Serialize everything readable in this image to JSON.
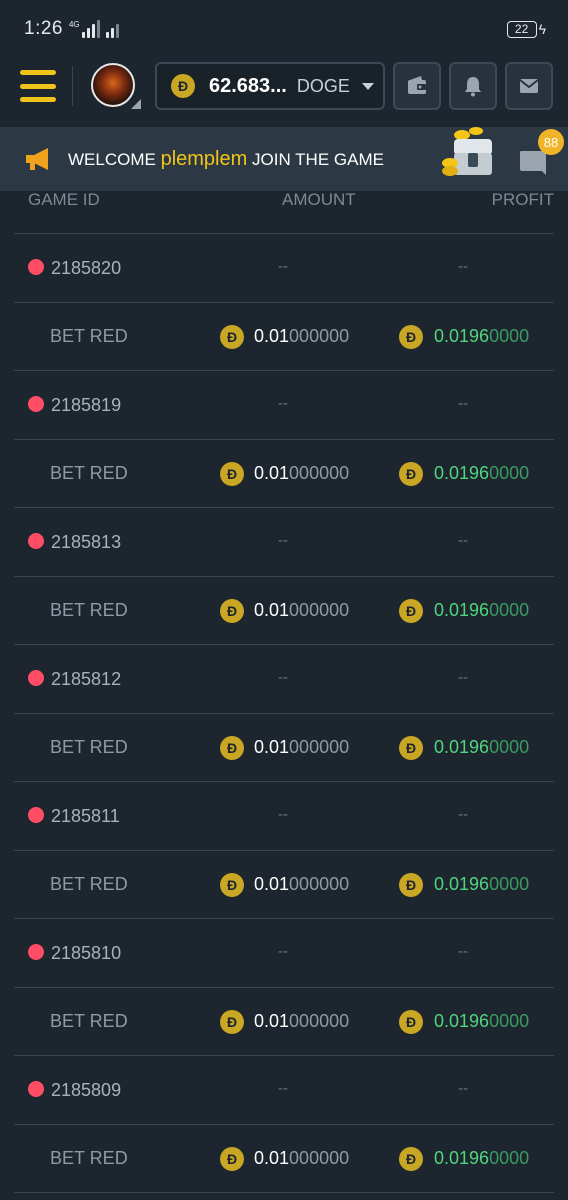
{
  "status_bar": {
    "time": "1:26",
    "network": "4G",
    "battery": "22"
  },
  "nav": {
    "balance_amount": "62.683...",
    "balance_currency": "DOGE",
    "coin_symbol": "Ð"
  },
  "banner": {
    "welcome": "WELCOME",
    "username": "plemplem",
    "join": "JOIN THE GAME",
    "message_count": "88"
  },
  "table": {
    "headers": {
      "game_id": "GAME ID",
      "amount": "AMOUNT",
      "profit": "PROFIT"
    },
    "dash": "--",
    "rows": [
      {
        "game_id": "2185820",
        "bet": "BET RED",
        "amount_hi": "0.01",
        "amount_lo": "000000",
        "profit_hi": "0.0196",
        "profit_lo": "0000"
      },
      {
        "game_id": "2185819",
        "bet": "BET RED",
        "amount_hi": "0.01",
        "amount_lo": "000000",
        "profit_hi": "0.0196",
        "profit_lo": "0000"
      },
      {
        "game_id": "2185813",
        "bet": "BET RED",
        "amount_hi": "0.01",
        "amount_lo": "000000",
        "profit_hi": "0.0196",
        "profit_lo": "0000"
      },
      {
        "game_id": "2185812",
        "bet": "BET RED",
        "amount_hi": "0.01",
        "amount_lo": "000000",
        "profit_hi": "0.0196",
        "profit_lo": "0000"
      },
      {
        "game_id": "2185811",
        "bet": "BET RED",
        "amount_hi": "0.01",
        "amount_lo": "000000",
        "profit_hi": "0.0196",
        "profit_lo": "0000"
      },
      {
        "game_id": "2185810",
        "bet": "BET RED",
        "amount_hi": "0.01",
        "amount_lo": "000000",
        "profit_hi": "0.0196",
        "profit_lo": "0000"
      },
      {
        "game_id": "2185809",
        "bet": "BET RED",
        "amount_hi": "0.01",
        "amount_lo": "000000",
        "profit_hi": "0.0196",
        "profit_lo": "0000"
      }
    ]
  },
  "colors": {
    "background": "#1d252e",
    "accent": "#f0c419",
    "red_dot": "#ff4d66",
    "profit": "#4fd67e"
  }
}
